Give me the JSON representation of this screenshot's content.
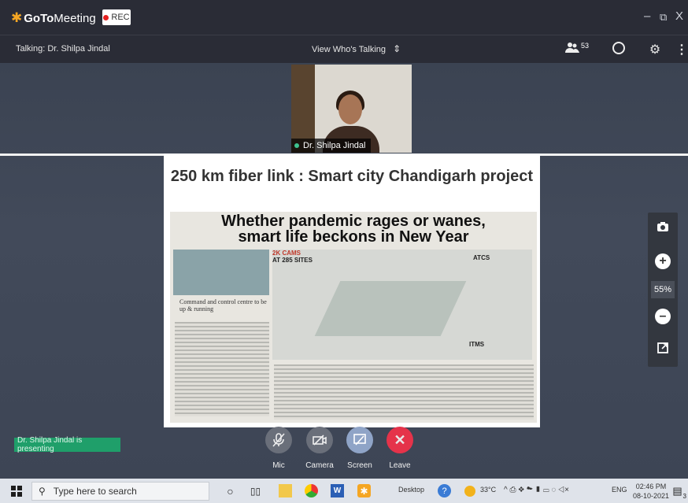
{
  "app": {
    "name_bold": "GoTo",
    "name_rest": "Meeting",
    "rec_label": "REC"
  },
  "window_controls": {
    "minimize": "–",
    "restore": "⧉",
    "close": "X"
  },
  "info_bar": {
    "talking": "Talking: Dr. Shilpa Jindal",
    "view_mode": "View Who's Talking",
    "attendee_count": "53"
  },
  "video_tile": {
    "name": "Dr. Shilpa Jindal"
  },
  "slide": {
    "title": "250 km fiber link : Smart city  Chandigarh project",
    "newspaper_headline_line1": "Whether pandemic rages or wanes,",
    "newspaper_headline_line2": "smart life beckons in New Year",
    "news_caption_1": "2K CAMS",
    "news_caption_2": "AT 285 SITES",
    "news_caption_3": "Command and control centre to be up & running",
    "news_caption_4": "ATCS",
    "news_caption_5": "ITMS"
  },
  "zoom": {
    "percent": "55%"
  },
  "presenting_badge": "Dr. Shilpa Jindal is presenting",
  "controls": [
    {
      "label": "Mic",
      "icon": "mic-muted-icon",
      "color": "#6a6f7a"
    },
    {
      "label": "Camera",
      "icon": "camera-off-icon",
      "color": "#6a6f7a"
    },
    {
      "label": "Screen",
      "icon": "screen-share-icon",
      "color": "#8fa4c7"
    },
    {
      "label": "Leave",
      "icon": "close-icon",
      "color": "#e5334a"
    }
  ],
  "taskbar": {
    "search_placeholder": "Type here to search",
    "desktop_label": "Desktop",
    "temperature": "33°C",
    "language": "ENG",
    "time": "02:46 PM",
    "date": "08-10-2021",
    "notification_count": "3"
  }
}
